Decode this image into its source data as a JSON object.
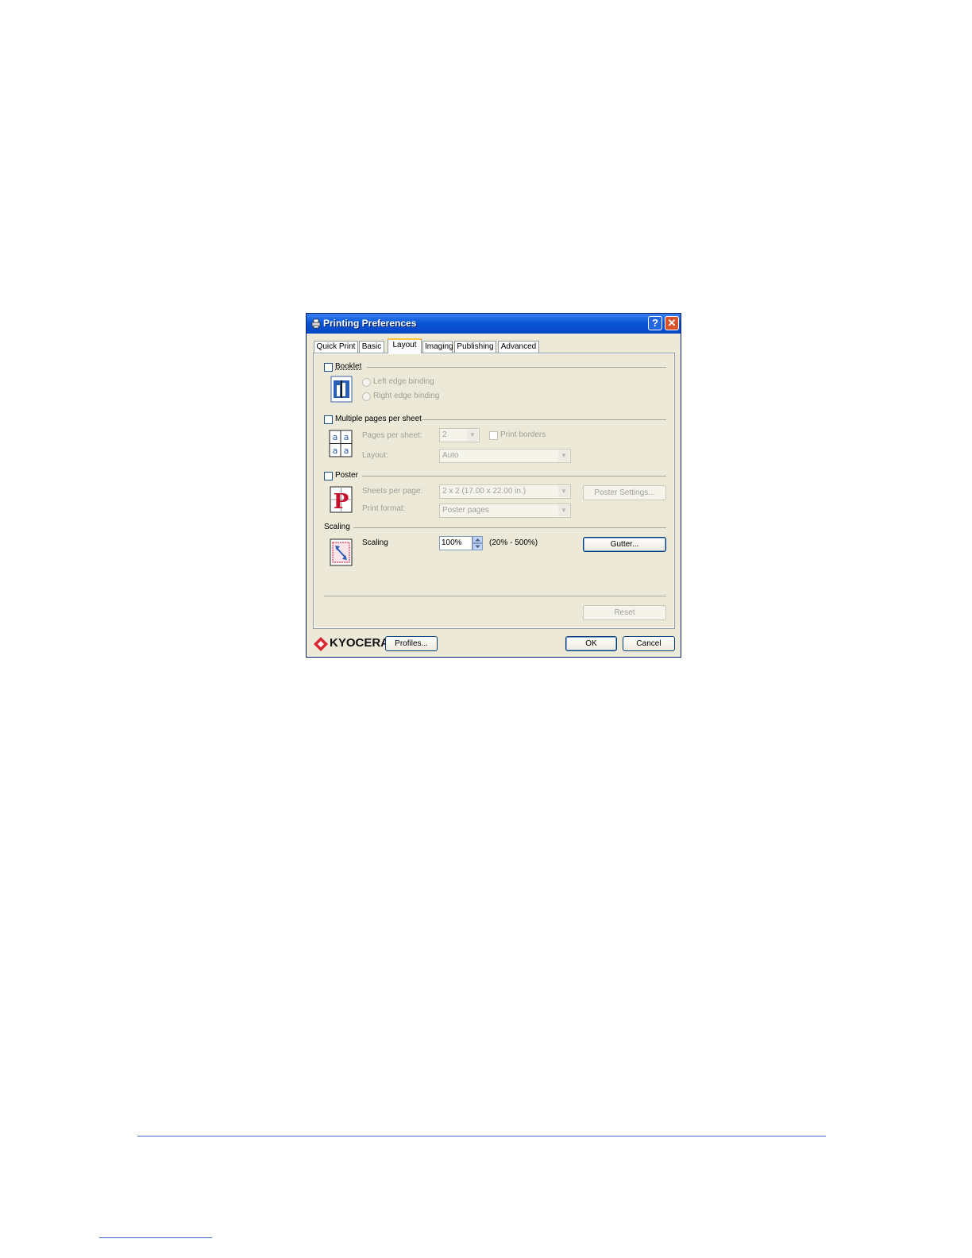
{
  "dialog": {
    "title": "Printing Preferences",
    "help_label": "?",
    "close_label": "✕"
  },
  "tabs": [
    {
      "label": "Quick Print"
    },
    {
      "label": "Basic"
    },
    {
      "label": "Layout",
      "active": true
    },
    {
      "label": "Imaging"
    },
    {
      "label": "Publishing"
    },
    {
      "label": "Advanced"
    }
  ],
  "booklet": {
    "label": "Booklet",
    "checked": false,
    "options": [
      "Left edge binding",
      "Right edge binding"
    ]
  },
  "multiple_pages": {
    "label": "Multiple pages per sheet",
    "checked": false,
    "pages_per_sheet_label": "Pages per sheet:",
    "pages_per_sheet_value": "2",
    "print_borders_label": "Print borders",
    "layout_label": "Layout:",
    "layout_value": "Auto",
    "icon_glyph": "a"
  },
  "poster": {
    "label": "Poster",
    "checked": false,
    "sheets_per_page_label": "Sheets per page:",
    "sheets_per_page_value": "2 x 2 (17.00 x 22.00 in.)",
    "print_format_label": "Print format:",
    "print_format_value": "Poster pages",
    "settings_button": "Poster Settings...",
    "icon_glyph": "P"
  },
  "scaling": {
    "section_label": "Scaling",
    "field_label": "Scaling",
    "value": "100%",
    "range": "(20% - 500%)",
    "gutter_button": "Gutter..."
  },
  "reset_button": "Reset",
  "footer": {
    "brand": "KYOCERA",
    "profiles_button": "Profiles...",
    "ok_button": "OK",
    "cancel_button": "Cancel"
  },
  "colors": {
    "titlebar": "#0a57d6",
    "dialog_bg": "#ece9d8",
    "brand_red": "#d7262f",
    "page_rule": "#3b6fd0"
  }
}
